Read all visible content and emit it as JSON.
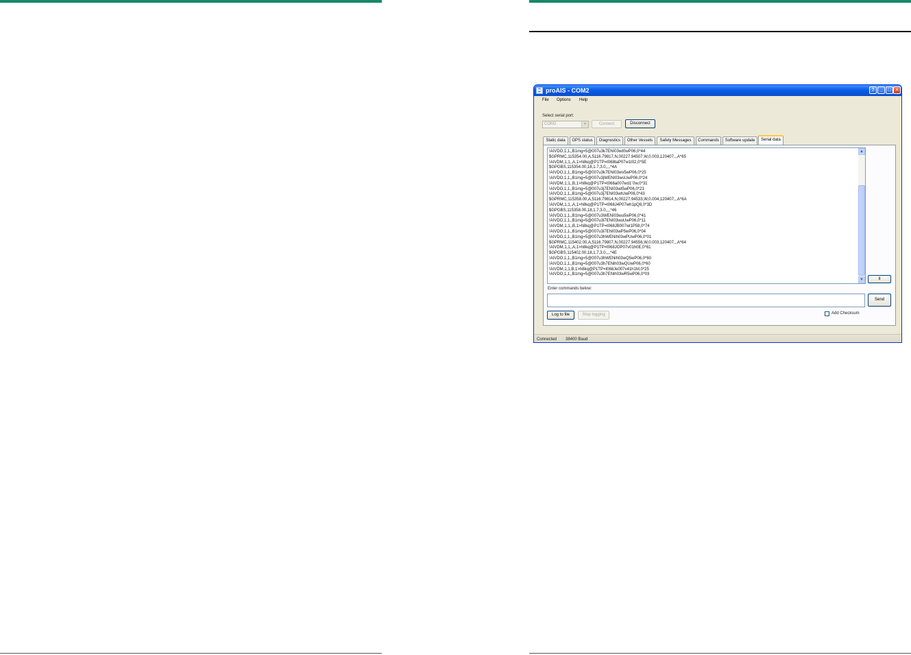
{
  "window": {
    "title": "proAIS - COM2"
  },
  "menu": {
    "file": "File",
    "options": "Options",
    "help": "Help"
  },
  "serial": {
    "label": "Select serial port:",
    "port_value": "COM2",
    "connect_label": "Connect",
    "disconnect_label": "Disconnect"
  },
  "tabs": [
    {
      "label": "Static data"
    },
    {
      "label": "GPS status"
    },
    {
      "label": "Diagnostics"
    },
    {
      "label": "Other Vessels"
    },
    {
      "label": "Safety Messages"
    },
    {
      "label": "Commands"
    },
    {
      "label": "Software update"
    },
    {
      "label": "Serial data"
    }
  ],
  "log_lines": [
    "!AIVDO,1,1,,B1mg=5@007u3k7ENI03wt0wP06,0*44",
    "$GPRMC,115354.00,A,5116.79817,N,00227.94507,W,0.003,120407,,,A*65",
    "!AIVDM,1,1,,A,1>h8kq@P1TP=t068taP07w1t02,0*5E",
    "$GPGBS,115354.00,18,1.7,3.0,,,,*4A",
    "!AIVDO,1,1,,B1mg=5@007u3k7ENI03wv5wP06,0*25",
    "!AIVDO,1,1,,B1mg=5@007u3jWENI03wsUwP06,0*24",
    "!AIVDM,1,1,,B,1>h8kq@P1TP=t068a007wd1`0w,0*31",
    "!AIVDO,1,1,,B1mg=5@007u3j7ENI03wt5wP06,0*23",
    "!AIVDO,1,1,,B1mg=5@007u3j7ENI03wtUwP06,0*43",
    "$GPRMC,115358.00,A,5116.79814,N,00227.94533,W,0.004,120407,,,A*6A",
    "!AIVDM,1,1,,A,1>h8kq@P1TP=t068J4P07wh1pQ8,0*3D",
    "$GPGBS,115358.00,18,1.7,3.0,,,,*46",
    "!AIVDO,1,1,,B1mg=5@007u3WENI03wu5wP06,0*41",
    "!AIVDO,1,1,,B1mg=5@007u3i7ENI03wuUwP06,0*11",
    "!AIVDM,1,1,,B,1>h8kq@P1TP=t068JB007wl1P58,0*74",
    "!AIVDO,1,1,,B1mg=5@007u3i7ENI03wP5wP06,0*04",
    "!AIVDO,1,1,,B1mg=5@007u3hWENih03wPUwP06,0*01",
    "$GPRMC,115402.00,A,5116.79807,N,00227.94556,W,0.003,120407,,,A*64",
    "!AIVDM,1,1,,A,1>h8kq@P1TP=t068JOP07v01h0E,0*61",
    "$GPGBS,115402.00,18,1.7,3.0,,,,*4E",
    "!AIVDO,1,1,,B1mg=5@007u3hWENih03wQ5wP06,0*60",
    "!AIVDO,1,1,,B1mg=5@007u3h7ENih03wQUwP06,0*60",
    "!AIVDM,1,1,B,1>h8kq@P1TP=t068Je007v41h1M,0*25",
    "!AIVDO,1,1,,B1mg=5@007u3h7ENih03wR5wP06,0*03"
  ],
  "pause_label": "II",
  "commands": {
    "label": "Enter commands below:",
    "value": "",
    "send_label": "Send"
  },
  "logging": {
    "log_to_file_label": "Log to file",
    "stop_logging_label": "Stop logging"
  },
  "checksum": {
    "label": "Add Checksum",
    "checked": false
  },
  "status": {
    "connection": "Connected",
    "baud": "38400 Baud"
  },
  "colors": {
    "accent_green": "#18876a",
    "xp_blue": "#0a5ce8",
    "window_bg": "#ece9d8"
  }
}
